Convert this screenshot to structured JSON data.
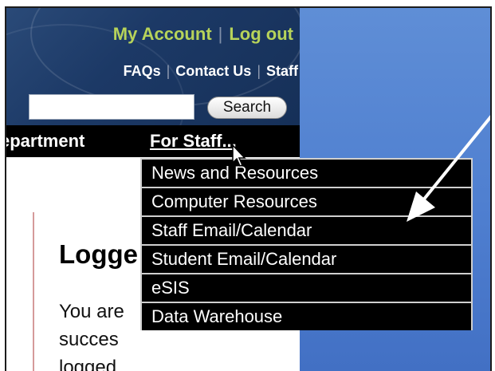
{
  "header": {
    "my_account": "My Account",
    "log_out": "Log out",
    "links": [
      "FAQs",
      "Contact Us",
      "Staff"
    ]
  },
  "search": {
    "input_value": "",
    "button_label": "Search"
  },
  "nav": {
    "department": "epartment",
    "for_staff": "For Staff..."
  },
  "dropdown": {
    "items": [
      "News and Resources",
      "Computer Resources",
      "Staff Email/Calendar",
      "Student Email/Calendar",
      "eSIS",
      "Data Warehouse"
    ]
  },
  "content": {
    "title": "Logge",
    "lines": [
      "You are",
      "succes",
      "logged"
    ]
  },
  "colors": {
    "background_blue": "#4f7fd0",
    "header_navy": "#1c3966",
    "account_green": "#b7d35a",
    "nav_black": "#000000",
    "annotation_arrow": "#ffffff"
  },
  "icons": [
    "mouse-pointer-icon",
    "annotation-arrow"
  ]
}
